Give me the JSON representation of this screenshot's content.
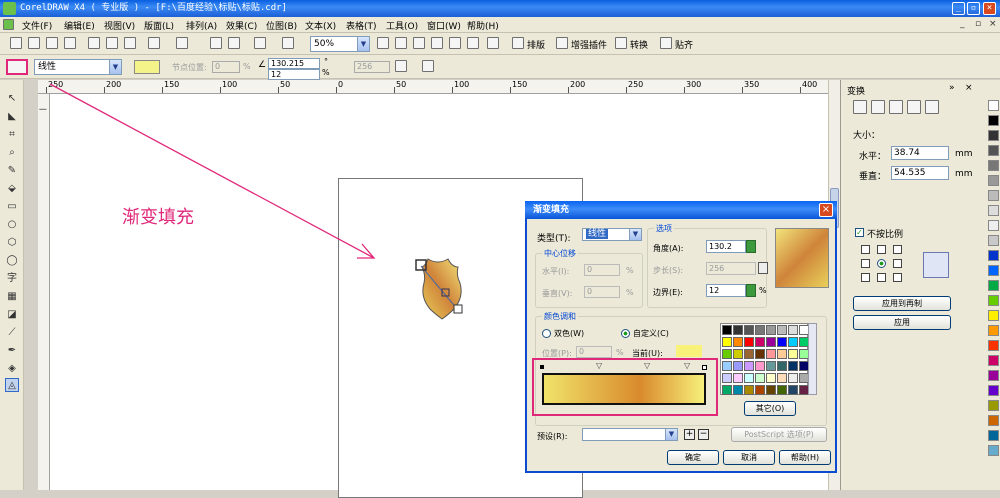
{
  "window": {
    "title": "CorelDRAW X4 ( 专业版 ) - [F:\\百度经验\\标贴\\标贴.cdr]"
  },
  "menu": [
    "文件(F)",
    "编辑(E)",
    "视图(V)",
    "版面(L)",
    "排列(A)",
    "效果(C)",
    "位图(B)",
    "文本(X)",
    "表格(T)",
    "工具(O)",
    "窗口(W)",
    "帮助(H)"
  ],
  "toolbar": {
    "zoom": "50%",
    "buttons": [
      "排版",
      "增强插件",
      "转换",
      "贴齐"
    ]
  },
  "property_bar": {
    "fill_type": "线性",
    "node_position_label": "节点位置:",
    "node_position_value": "0",
    "node_position_unit": "%",
    "angle": "130.215",
    "angle_unit": "°",
    "edge": "12",
    "edge_unit": "%",
    "steps": "256"
  },
  "ruler": {
    "h_labels": [
      "250",
      "200",
      "150",
      "100",
      "50",
      "0",
      "50",
      "100",
      "150",
      "200",
      "250",
      "300",
      "350",
      "400"
    ]
  },
  "annotation": {
    "text": "渐变填充",
    "color": "#e0287a"
  },
  "dialog": {
    "title": "渐变填充",
    "type_label": "类型(T):",
    "type_value": "线性",
    "center_group": "中心位移",
    "horizontal_label": "水平(I):",
    "horizontal_value": "0",
    "vertical_label": "垂直(V):",
    "vertical_value": "0",
    "percent": "%",
    "options_group": "选项",
    "angle_label": "角度(A):",
    "angle_value": "130.2",
    "steps_label": "步长(S):",
    "steps_value": "256",
    "edge_label": "边界(E):",
    "edge_value": "12",
    "color_group": "颜色调和",
    "two_color": "双色(W)",
    "custom": "自定义(C)",
    "position_label": "位置(P):",
    "position_value": "0",
    "current_label": "当前(U):",
    "other_button": "其它(O)",
    "preset_label": "预设(R):",
    "postscript_button": "PostScript 选项(P)",
    "ok": "确定",
    "cancel": "取消",
    "help": "帮助(H)"
  },
  "docker": {
    "title": "变换",
    "size_label": "大小：",
    "h_label": "水平：",
    "h_value": "38.74",
    "v_label": "垂直：",
    "v_value": "54.535",
    "unit": "mm",
    "nonprop": "不按比例",
    "apply_copy": "应用到再制",
    "apply": "应用"
  },
  "colors": {
    "grad_start": "#f0e36a",
    "grad_mid": "#d98a2c",
    "grad_end": "#f7f07a",
    "highlight": "#e0287a"
  }
}
